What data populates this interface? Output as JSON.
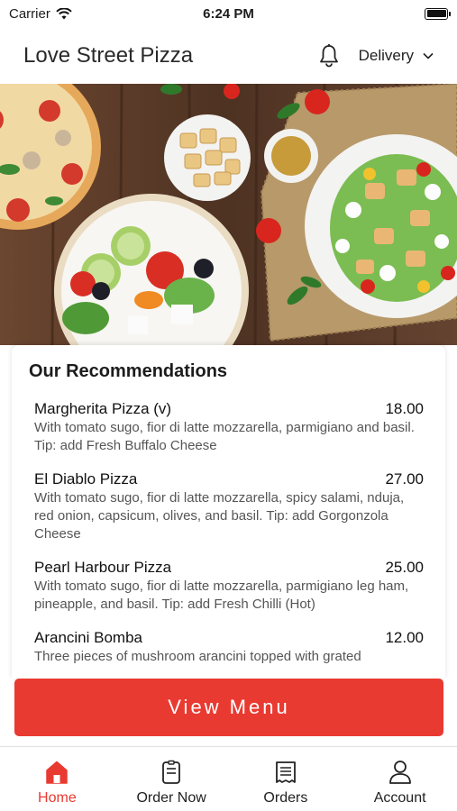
{
  "status_bar": {
    "carrier": "Carrier",
    "time": "6:24 PM"
  },
  "header": {
    "title": "Love Street Pizza",
    "mode": "Delivery"
  },
  "hero": {
    "icon": "food-banner-image"
  },
  "recommendations": {
    "title": "Our Recommendations",
    "items": [
      {
        "name": "Margherita Pizza (v)",
        "price": "18.00",
        "description": "With tomato sugo, fior di latte mozzarella, parmigiano and basil. Tip: add Fresh Buffalo Cheese"
      },
      {
        "name": "El Diablo Pizza",
        "price": "27.00",
        "description": "With tomato sugo, fior di latte mozzarella, spicy salami, nduja, red onion, capsicum, olives, and basil. Tip: add Gorgonzola Cheese"
      },
      {
        "name": "Pearl Harbour Pizza",
        "price": "25.00",
        "description": "With tomato sugo, fior di latte mozzarella, parmigiano leg ham, pineapple, and basil. Tip: add Fresh Chilli (Hot)"
      },
      {
        "name": "Arancini Bomba",
        "price": "12.00",
        "description": "Three pieces of mushroom arancini topped with grated"
      }
    ]
  },
  "view_menu_label": "View Menu",
  "tabs": [
    {
      "label": "Home",
      "icon": "home-icon",
      "active": true
    },
    {
      "label": "Order Now",
      "icon": "order-now-icon",
      "active": false
    },
    {
      "label": "Orders",
      "icon": "orders-receipt-icon",
      "active": false
    },
    {
      "label": "Account",
      "icon": "account-icon",
      "active": false
    }
  ],
  "colors": {
    "accent": "#e93a31",
    "text": "#1c1c1c",
    "muted": "#555555"
  }
}
